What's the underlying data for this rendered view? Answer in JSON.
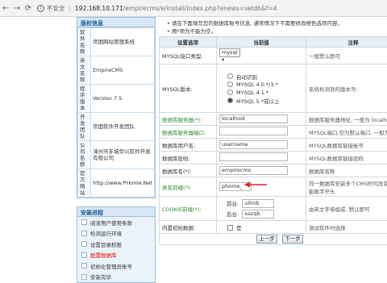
{
  "browser": {
    "security_label": "不安全",
    "url_host": "192.168.10.171",
    "url_path": "/empirecms/e/install/index.php?enews=setdb&f=4"
  },
  "sidebar": {
    "info_title": "版权信息",
    "info_rows": [
      {
        "k": "软件名称",
        "v": "帝国网站管理系统"
      },
      {
        "k": "英文名称",
        "v": "EmpireCMS"
      },
      {
        "k": "程序版本",
        "v": "Version 7.5"
      },
      {
        "k": "开发团队",
        "v": "帝国软件开发团队"
      },
      {
        "k": "公司名称",
        "v": "漳州市芗城帝兴软件开发有限公司"
      },
      {
        "k": "官方网站",
        "v": "http://www.PHome.Net"
      }
    ],
    "steps_title": "安装进程",
    "steps": [
      "阅读用户使用条款",
      "检测运行环境",
      "设置目录权限",
      "配置数据库",
      "初始化管理员账号",
      "安装完毕"
    ],
    "active_step": 3
  },
  "main": {
    "notes": [
      "请在下面填写您的数据库账号信息, 通常情况下不需要修改橙色选项内容。",
      "用*项为不能为空。"
    ],
    "headers": [
      "设置选项",
      "当前值",
      "注释"
    ],
    "mysql_interface": {
      "label": "MYSQL接口类型:",
      "value": "mysql",
      "note": "一般默认即可"
    },
    "mysql_version": {
      "label": "MYSQL版本:",
      "options": [
        "自动识别",
        "MYSQL 4.0.*/3.*",
        "MYSQL 4.1.*",
        "MYSQL 5.*或以上"
      ],
      "selected": 3,
      "note": "系统检测到的版本号:"
    },
    "db_server": {
      "label": "数据库服务器(*):",
      "value": "localhost",
      "note": "数据库服务器地址, 一般为 localho"
    },
    "db_port": {
      "label": "数据库服务器端口:",
      "value": "",
      "note": "MYSQL端口,空为默认端口, 一般为空"
    },
    "db_user": {
      "label": "数据库用户名:",
      "value": "username",
      "note": "MYSQL数据库链接账号"
    },
    "db_pass": {
      "label": "数据库密码:",
      "value": "",
      "note": "MYSQL数据库链接密码"
    },
    "db_name": {
      "label": "数据库名(*):",
      "value": "empirecms",
      "note": "数据库名称"
    },
    "table_prefix": {
      "label": "表名前缀(*):",
      "value": "phome_",
      "note": "同一数据库安装多个CMS时可改变",
      "note2": "能数字开头"
    },
    "cookie_prefix": {
      "label": "COOKIE前缀(*):",
      "front_label": "前台:",
      "front_value": "uihnb",
      "back_label": "后台:",
      "back_value": "xazqb",
      "note": "由英文字母组成, 默认即可"
    },
    "builtin_data": {
      "label": "内置初始数据:",
      "checkbox_label": "是",
      "note": "测试软件时选择"
    },
    "buttons": {
      "prev": "上一步",
      "next": "下一步"
    }
  },
  "colors": {
    "green_label": "#2d8c2d",
    "red_arrow": "#e02020",
    "active_step": "#ee0000"
  }
}
